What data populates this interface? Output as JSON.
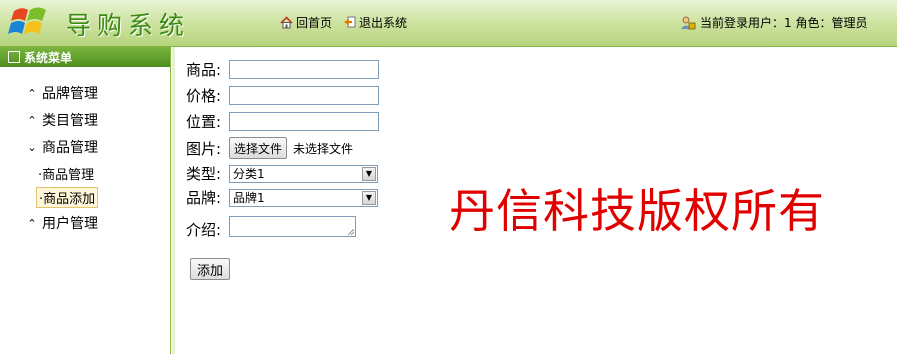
{
  "header": {
    "app_title": "导购系统",
    "nav": {
      "home_label": "回首页",
      "logout_label": "退出系统"
    },
    "user_info": "当前登录用户：1 角色：管理员"
  },
  "sidebar": {
    "title": "系统菜单",
    "items": [
      {
        "label": "品牌管理",
        "icon": "chevron-up-icon",
        "expanded": false
      },
      {
        "label": "类目管理",
        "icon": "chevron-up-icon",
        "expanded": false
      },
      {
        "label": "商品管理",
        "icon": "chevron-down-icon",
        "expanded": true,
        "children": [
          {
            "label": "商品管理",
            "active": false
          },
          {
            "label": "商品添加",
            "active": true
          }
        ]
      },
      {
        "label": "用户管理",
        "icon": "chevron-up-icon",
        "expanded": false
      }
    ]
  },
  "form": {
    "name_label": "商品:",
    "name_value": "",
    "price_label": "价格:",
    "price_value": "",
    "position_label": "位置:",
    "position_value": "",
    "image_label": "图片:",
    "file_button": "选择文件",
    "file_status": "未选择文件",
    "type_label": "类型:",
    "type_selected": "分类1",
    "brand_label": "品牌:",
    "brand_selected": "品牌1",
    "intro_label": "介绍:",
    "intro_value": "",
    "submit_label": "添加"
  },
  "watermark": "丹信科技版权所有",
  "colors": {
    "header_green": "#b6d47c",
    "title_green": "#3b8a12",
    "sidebar_header": "#4f8c1f",
    "watermark_red": "#e00000"
  }
}
